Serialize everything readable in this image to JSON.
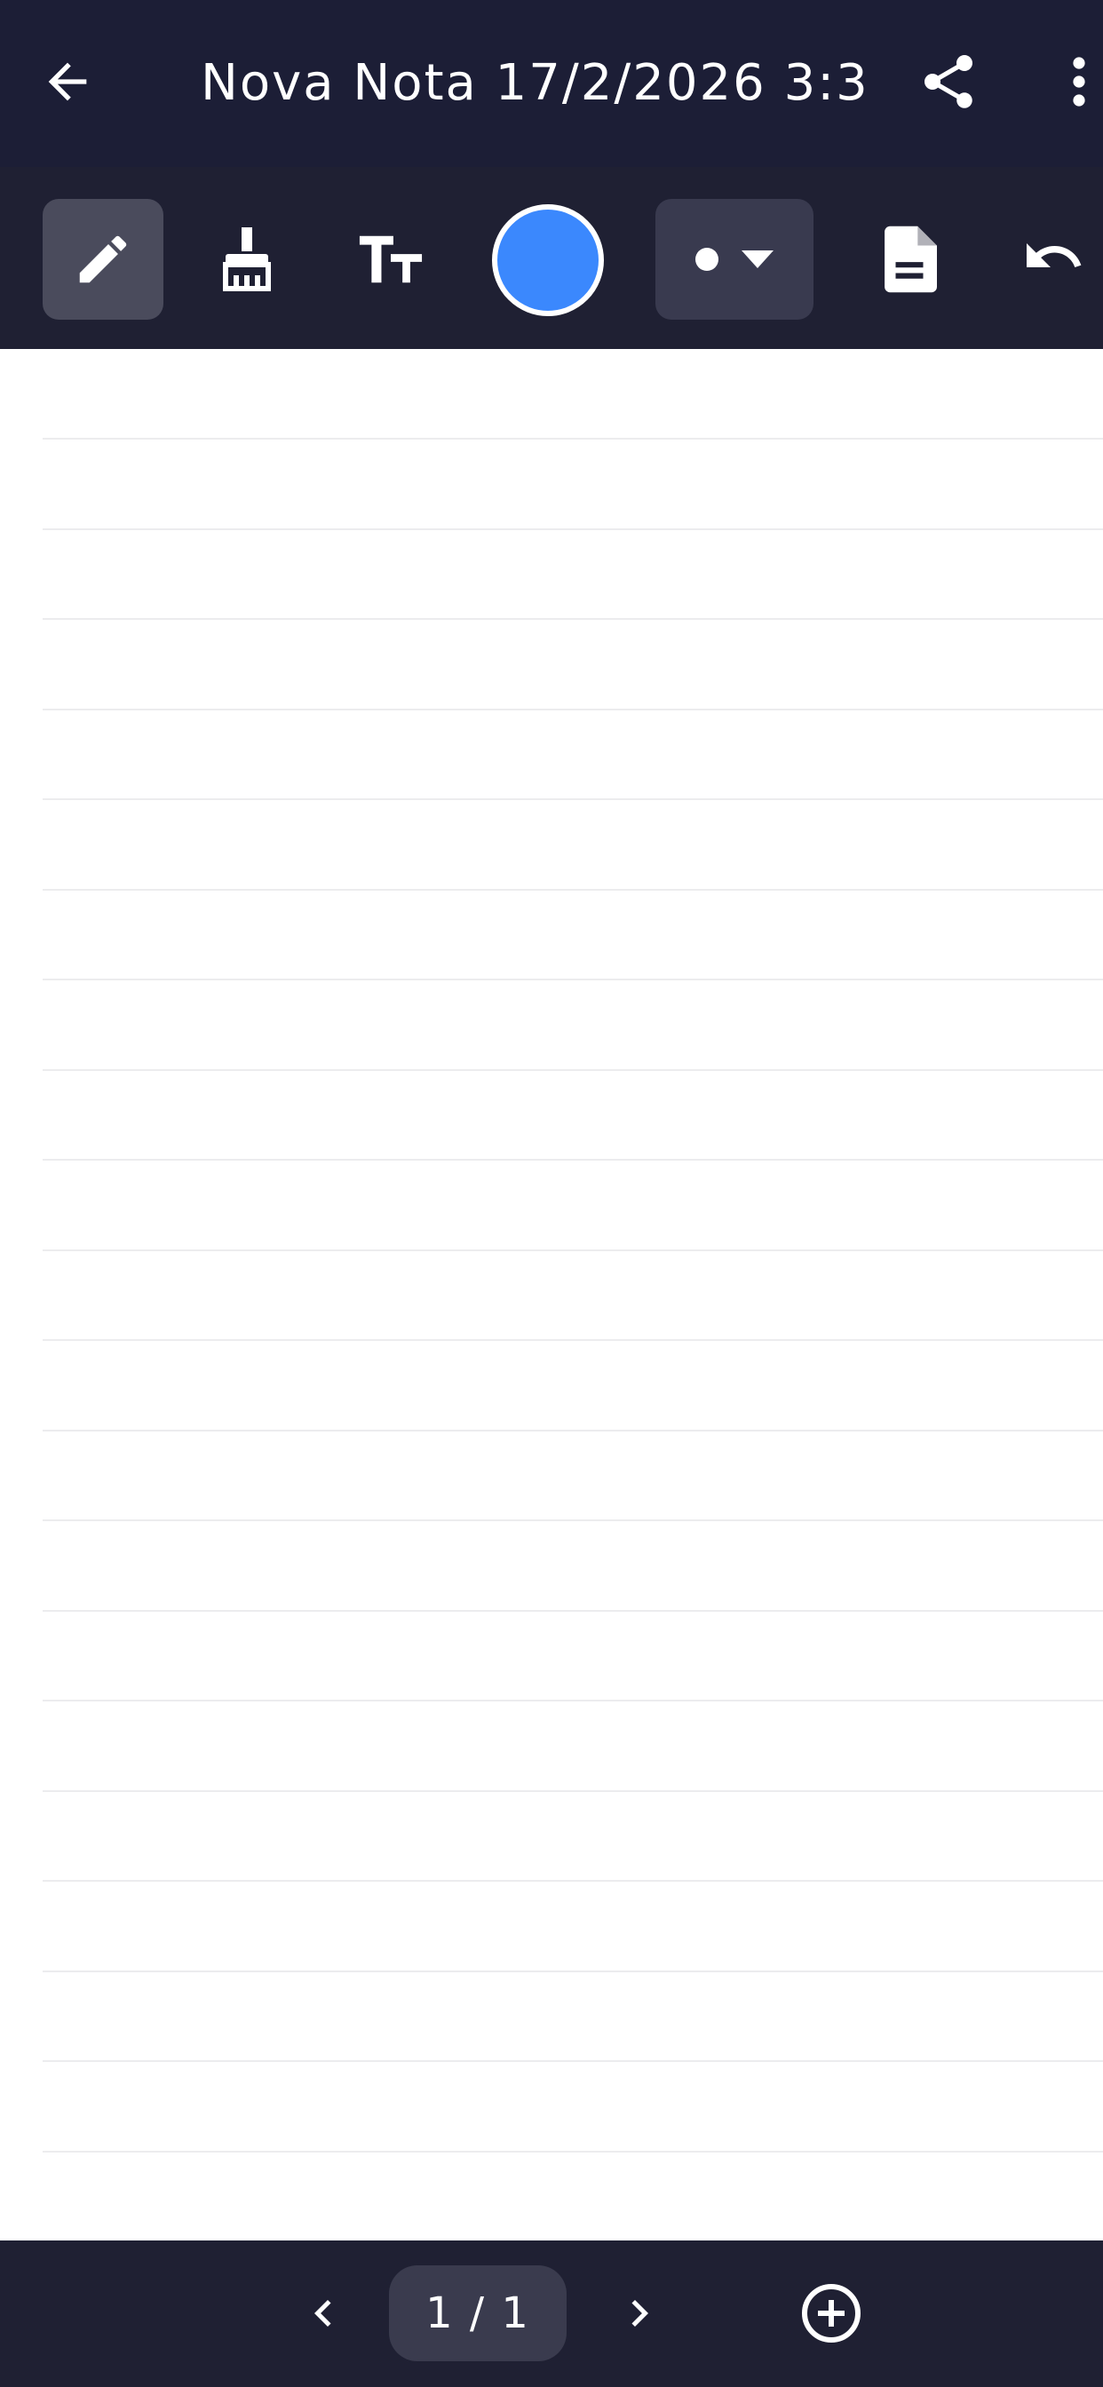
{
  "header": {
    "title": "Nova Nota 17/2/2026 3:3",
    "back_icon": "arrow-left-icon",
    "share_icon": "share-icon",
    "more_icon": "more-vertical-icon"
  },
  "toolbar": {
    "pen_icon": "pencil-icon",
    "eraser_icon": "brush-icon",
    "text_icon": "text-size-icon",
    "color": "#3b88fd",
    "size_icon": "dot-icon",
    "size_dropdown_icon": "caret-down-icon",
    "page_style_icon": "document-icon",
    "undo_icon": "undo-icon",
    "active_tool": "pen"
  },
  "footer": {
    "page_indicator": "1 / 1",
    "prev_icon": "chevron-left-icon",
    "next_icon": "chevron-right-icon",
    "add_page_icon": "plus-circle-icon"
  },
  "colors": {
    "header_bg": "#1c1e36",
    "toolbar_bg": "#1f2033",
    "active_tool_bg": "#4a4b5c",
    "canvas_bg": "#ffffff",
    "rule_line": "#ececee"
  }
}
